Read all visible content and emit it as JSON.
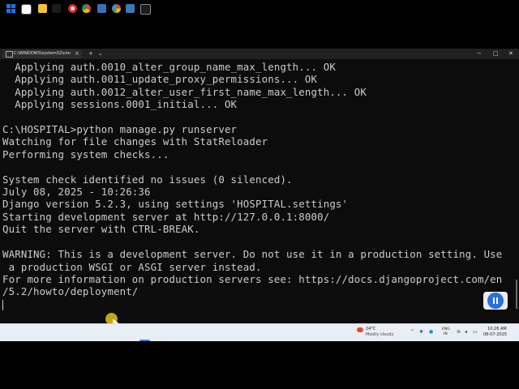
{
  "window": {
    "tab_title": "C:\\WINDOWS\\system32\\cmd.",
    "tab_close": "×",
    "new_tab": "+",
    "dropdown": "⌄",
    "minimize": "−",
    "maximize": "□",
    "close": "✕"
  },
  "terminal": {
    "lines": [
      "  Applying auth.0010_alter_group_name_max_length... OK",
      "  Applying auth.0011_update_proxy_permissions... OK",
      "  Applying auth.0012_alter_user_first_name_max_length... OK",
      "  Applying sessions.0001_initial... OK",
      "",
      "C:\\HOSPITAL>python manage.py runserver",
      "Watching for file changes with StatReloader",
      "Performing system checks...",
      "",
      "System check identified no issues (0 silenced).",
      "July 08, 2025 - 10:26:36",
      "Django version 5.2.3, using settings 'HOSPITAL.settings'",
      "Starting development server at http://127.0.0.1:8000/",
      "Quit the server with CTRL-BREAK.",
      "",
      "WARNING: This is a development server. Do not use it in a production setting. Use",
      " a production WSGI or ASGI server instead.",
      "For more information on production servers see: https://docs.djangoproject.com/en",
      "/5.2/howto/deployment/"
    ],
    "text_color": "#cccccc",
    "background": "#0c0c0c"
  },
  "taskbar": {
    "weather_temp": "24°C",
    "weather_condition": "Mostly cloudy",
    "lang_top": "ENG",
    "lang_bottom": "IN",
    "time": "10:26 AM",
    "date": "08-07-2025",
    "tray_icons": [
      "chevron-up-icon",
      "bluetooth-icon",
      "edge-icon",
      "wifi-icon",
      "speaker-icon",
      "battery-icon"
    ]
  }
}
